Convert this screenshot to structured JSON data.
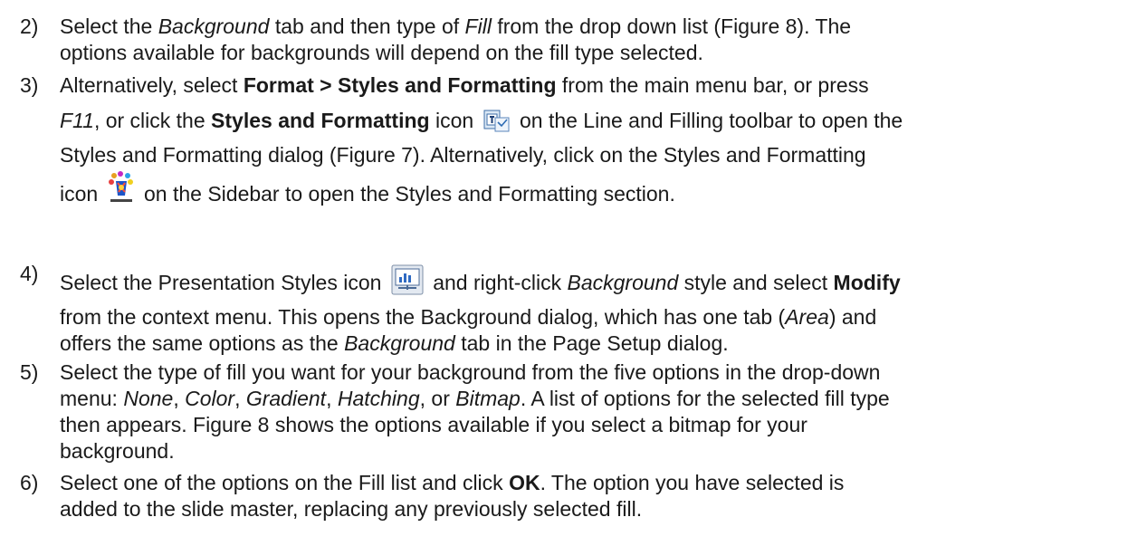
{
  "steps": [
    {
      "num": "2)",
      "lines": [
        [
          "Select the ",
          {
            "i": "Background"
          },
          " tab and then type of ",
          {
            "i": "Fill"
          },
          " from the drop down list (Figure 8). The"
        ],
        [
          "options available for backgrounds will depend on the fill type selected."
        ]
      ]
    },
    {
      "num": "3)",
      "lines": [
        [
          "Alternatively, select ",
          {
            "b": "Format > Styles and Formatting"
          },
          " from the main menu bar, or press"
        ],
        [
          {
            "i": "F11"
          },
          ", or click the ",
          {
            "b": "Styles and Formatting"
          },
          " icon ",
          {
            "icon": "styles-formatting-toolbar-icon"
          },
          " on the Line and Filling toolbar to open the"
        ],
        [
          "Styles and Formatting dialog (Figure 7). Alternatively, click on the Styles and Formatting"
        ],
        [
          "icon ",
          {
            "icon": "styles-formatting-sidebar-icon"
          },
          " on the Sidebar to open the Styles and Formatting section."
        ]
      ]
    },
    {
      "num": "4)",
      "lines": [
        [
          "Select the Presentation Styles icon ",
          {
            "icon": "presentation-styles-icon"
          },
          " and right-click ",
          {
            "i": "Background"
          },
          " style and select ",
          {
            "b": "Modify"
          }
        ],
        [
          "from the context menu. This opens the Background dialog, which has one tab (",
          {
            "i": "Area"
          },
          ") and"
        ],
        [
          "offers the same options as the ",
          {
            "i": "Background"
          },
          " tab in the Page Setup dialog."
        ]
      ]
    },
    {
      "num": "5)",
      "lines": [
        [
          "Select the type of fill you want for your background from the five options in the drop-down"
        ],
        [
          "menu: ",
          {
            "i": "None"
          },
          ", ",
          {
            "i": "Color"
          },
          ", ",
          {
            "i": "Gradient"
          },
          ", ",
          {
            "i": "Hatching"
          },
          ", or ",
          {
            "i": "Bitmap"
          },
          ". A list of options for the selected fill type"
        ],
        [
          "then appears. Figure 8 shows the options available if you select a bitmap for your"
        ],
        [
          "background."
        ]
      ]
    },
    {
      "num": "6)",
      "lines": [
        [
          "Select one of the options on the Fill list and click ",
          {
            "b": "OK"
          },
          ". The option you have selected is"
        ],
        [
          "added to the slide master, replacing any previously selected fill."
        ]
      ]
    }
  ]
}
